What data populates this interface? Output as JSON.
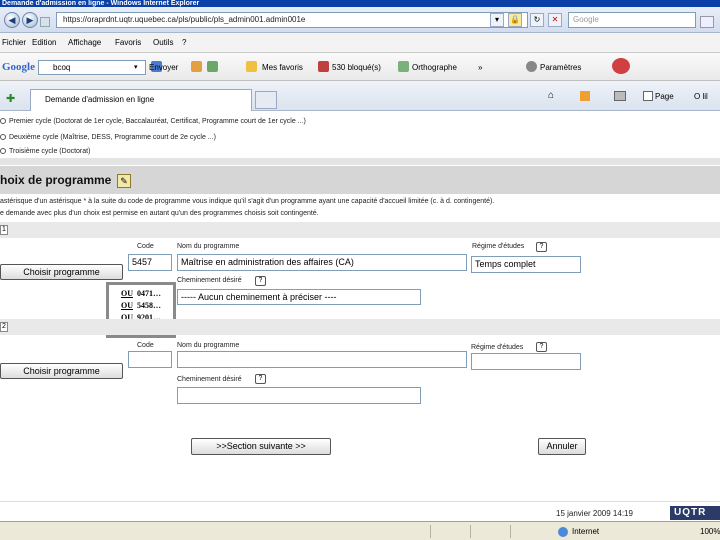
{
  "window": {
    "title": "Demande d'admission en ligne - Windows Internet Explorer"
  },
  "address_bar": {
    "url": "https://oraprdnt.uqtr.uquebec.ca/pls/public/pls_admin001.admin001e",
    "search_placeholder": "Google"
  },
  "menu": {
    "items": [
      "Fichier",
      "Edition",
      "Affichage",
      "Favoris",
      "Outils",
      "?"
    ]
  },
  "google_toolbar": {
    "logo": "Google",
    "search_value": "bcoq",
    "items": {
      "envoyer": "Envoyer",
      "favoris": "Mes favoris",
      "bloques": "530 bloqué(s)",
      "ortho": "Orthographe",
      "more": "»",
      "parametres": "Paramètres"
    }
  },
  "tabs": {
    "active_tab": "Demande d'admission en ligne",
    "right_items": {
      "page": "Page",
      "outils": "O lil"
    }
  },
  "cycles": [
    "Premier cycle (Doctorat de 1er cycle, Baccalauréat, Certificat, Programme court de 1er cycle ...)",
    "Deuxième cycle (Maîtrise, DESS, Programme court de 2e cycle ...)",
    "Troisième cycle (Doctorat)"
  ],
  "section": {
    "title": "hoix de programme",
    "notes": [
      "astérisque d'un astérisque * à la suite du code de programme vous indique qu'il s'agit d'un programme ayant une capacité d'accueil limitée (c. à d. contingenté).",
      "e demande avec plus d'un choix est permise en autant qu'un des programmes choisis soit contingenté."
    ]
  },
  "choice1": {
    "number": "1",
    "code_label": "Code",
    "code_value": "5457",
    "program_label": "Nom du programme",
    "program_value": "Maîtrise en administration des affaires (CA)",
    "regime_label": "Régime d'études",
    "regime_value": "Temps complet",
    "cheminement_label": "Cheminement désiré",
    "cheminement_value": "----- Aucun cheminement à préciser ----",
    "choose_button": "Choisir programme",
    "help": "?"
  },
  "dropdown": {
    "options": [
      {
        "prefix": "OU",
        "value": "0471…"
      },
      {
        "prefix": "OU",
        "value": "5458…"
      },
      {
        "prefix": "OU",
        "value": "9201…"
      }
    ]
  },
  "choice2": {
    "number": "2",
    "code_label": "Code",
    "code_value": "",
    "program_label": "Nom du programme",
    "program_value": "",
    "regime_label": "Régime d'études",
    "regime_value": "",
    "cheminement_label": "Cheminement désiré",
    "cheminement_value": "",
    "choose_button": "Choisir programme",
    "help": "?"
  },
  "actions": {
    "next": ">>Section suivante >>",
    "cancel": "Annuler"
  },
  "footer": {
    "date": "15 janvier 2009 14:19",
    "logo": "UQTR"
  },
  "status": {
    "zone": "Internet",
    "zoom": "100%"
  },
  "colors": {
    "titlebar": "#0a3fa8",
    "section_bar": "#d6d6d6",
    "logo_bg": "#2b3a66"
  }
}
